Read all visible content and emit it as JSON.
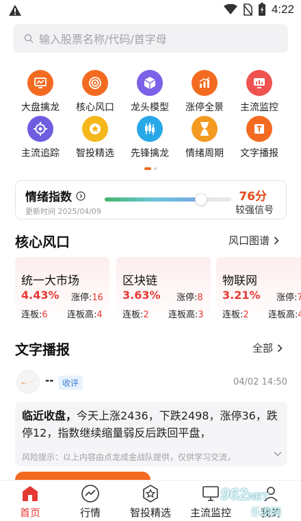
{
  "status_bar": {
    "time": "4:22"
  },
  "search": {
    "placeholder": "输入股票名称/代码/首字母"
  },
  "features": [
    {
      "label": "大盘擒龙",
      "icon": "monitor-chart-icon",
      "color": "#f36b21"
    },
    {
      "label": "核心风口",
      "icon": "target-icon",
      "color": "#f36b21"
    },
    {
      "label": "龙头模型",
      "icon": "cube-icon",
      "color": "#7b61e8"
    },
    {
      "label": "涨停全景",
      "icon": "bar-chart-icon",
      "color": "#f36b21"
    },
    {
      "label": "主流监控",
      "icon": "monitor-chart-icon",
      "color": "#ef5350"
    },
    {
      "label": "主流追踪",
      "icon": "crosshair-icon",
      "color": "#6f5de0"
    },
    {
      "label": "智投精选",
      "icon": "star-icon",
      "color": "#f5b81c"
    },
    {
      "label": "先锋擒龙",
      "icon": "candlestick-icon",
      "color": "#29a8e8"
    },
    {
      "label": "情绪周期",
      "icon": "hourglass-icon",
      "color": "#f39a21"
    },
    {
      "label": "文字播报",
      "icon": "text-doc-icon",
      "color": "#f36b21"
    }
  ],
  "sentiment": {
    "title": "情绪指数",
    "update_time": "更新时间 2025/04/09",
    "score": "76分",
    "signal": "较强信号",
    "level": 0.76
  },
  "hot_section": {
    "title": "核心风口",
    "link": "风口图谱"
  },
  "topics": [
    {
      "name": "统一大市场",
      "pct": "4.43%",
      "up_label": "涨停:",
      "up": "16",
      "lb_label": "连板:",
      "lb": "6",
      "lbh_label": "连板高:",
      "lbh": "4"
    },
    {
      "name": "区块链",
      "pct": "3.63%",
      "up_label": "涨停:",
      "up": "8",
      "lb_label": "连板:",
      "lb": "2",
      "lbh_label": "连板高:",
      "lbh": "3"
    },
    {
      "name": "物联网",
      "pct": "3.21%",
      "up_label": "涨停:",
      "up": "7",
      "lb_label": "连板:",
      "lb": "2",
      "lbh_label": "连板高:",
      "lbh": "4"
    }
  ],
  "broadcast_section": {
    "title": "文字播报",
    "link": "全部"
  },
  "broadcast": {
    "name": "--",
    "tag": "收评",
    "time": "04/02 14:50",
    "headline": "临近收盘，",
    "body": "今天上涨2436，下跌2498，涨停36，跌停12，指数继续缩量弱反后跌回平盘，",
    "risk": "风险提示：以上内容由点龙成金战队提供，仅供学习交流，"
  },
  "bottom_nav": [
    {
      "label": "首页",
      "icon": "home-icon",
      "active": true
    },
    {
      "label": "行情",
      "icon": "trend-icon",
      "active": false
    },
    {
      "label": "智投精选",
      "icon": "star-badge-icon",
      "active": false
    },
    {
      "label": "主流监控",
      "icon": "monitor-icon",
      "active": false
    },
    {
      "label": "我的",
      "icon": "user-icon",
      "active": false
    }
  ],
  "watermark": {
    "number": "962",
    "suffix": "NET",
    "text": "乐游网"
  },
  "colors": {
    "accent": "#f36b21",
    "red": "#e53935",
    "blue_tag": "#3a7bd5"
  }
}
